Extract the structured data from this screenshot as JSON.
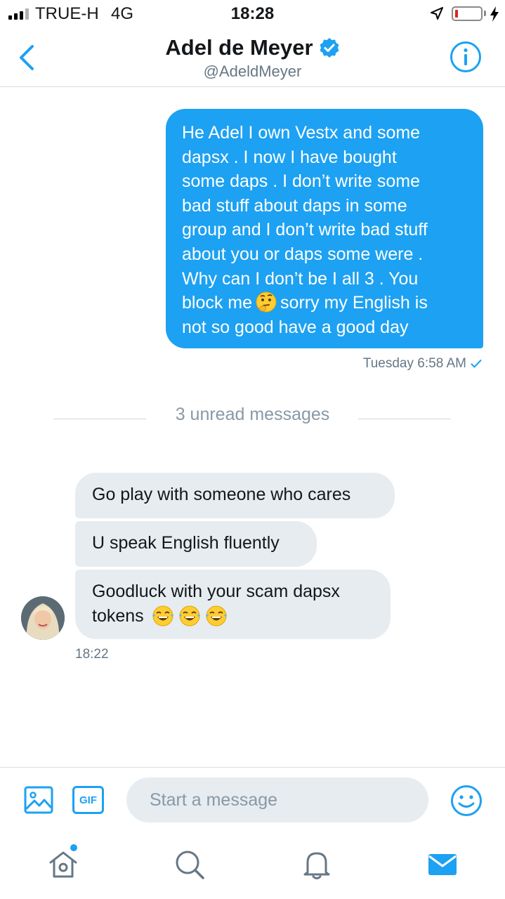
{
  "status_bar": {
    "carrier": "TRUE-H",
    "network": "4G",
    "time": "18:28",
    "signal_bars": 4,
    "signal_bars_active": 3,
    "battery_level": 0.1,
    "battery_color": "#e0231f"
  },
  "header": {
    "name": "Adel de Meyer",
    "handle": "@AdeldMeyer",
    "verified": true,
    "back_icon": "chevron-left-icon",
    "info_icon": "info-icon"
  },
  "conversation": {
    "sent": {
      "lines": [
        "He Adel I own Vestx and some",
        "dapsx . I now I have bought",
        "some daps . I don’t write some",
        "bad stuff about daps in some",
        "group and I don’t write bad stuff",
        "about you or daps some were .",
        "Why can I don’t be I all 3 . You",
        "block me",
        "sorry my English is",
        "not so good have a good day"
      ],
      "emoji": "thinking-face",
      "timestamp": "Tuesday 6:58 AM",
      "read_receipt": "checkmark-icon"
    },
    "unread_divider": "3 unread messages",
    "received": [
      {
        "text": "Go play with someone who cares"
      },
      {
        "text": "U speak English fluently"
      },
      {
        "line1": "Goodluck with your scam dapsx",
        "line2": "tokens",
        "emoji": "face-with-tears-of-joy",
        "emoji_count": 3
      }
    ],
    "received_time": "18:22"
  },
  "composer": {
    "placeholder": "Start a message",
    "gif_label": "GIF",
    "media_icon": "image-icon",
    "emoji_icon": "smiley-icon"
  },
  "tab_bar": {
    "items": [
      "home-icon",
      "search-icon",
      "notifications-icon",
      "messages-icon"
    ],
    "active": "messages-icon",
    "home_has_dot": true
  },
  "colors": {
    "accent": "#1da1f2",
    "bubble_received": "#e6ecf0",
    "muted_text": "#657786",
    "divider": "#ccd6dd"
  }
}
